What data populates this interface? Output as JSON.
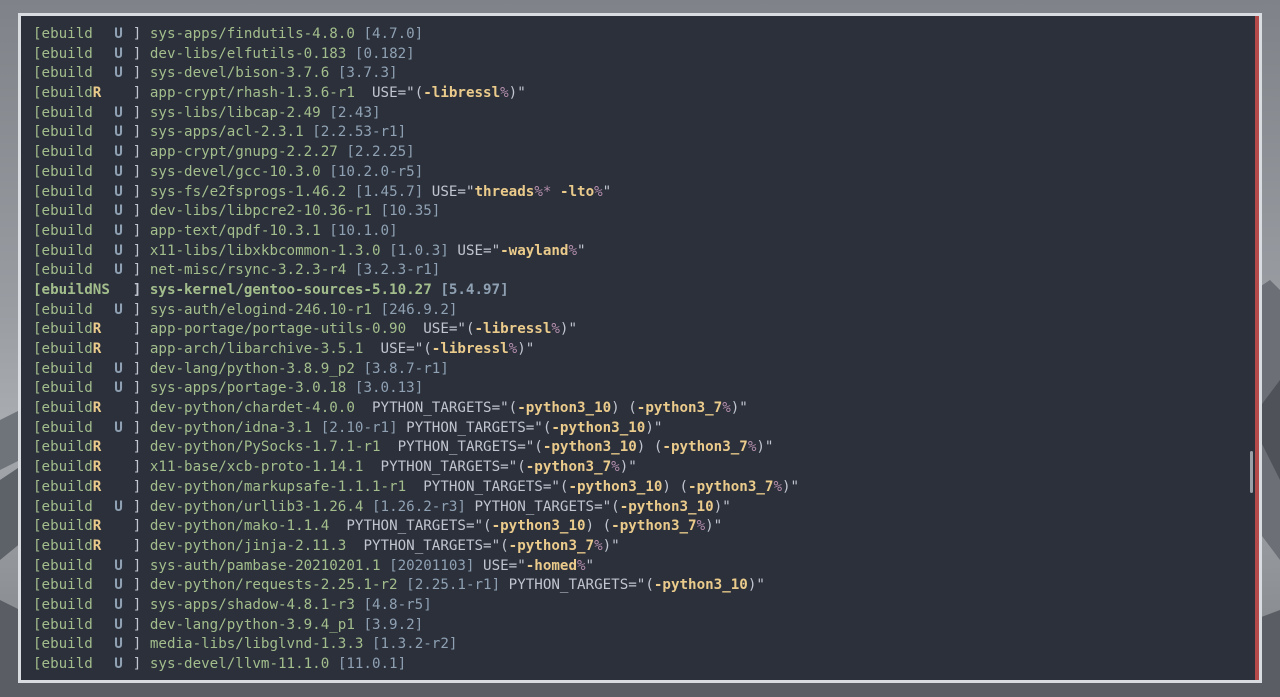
{
  "terminal": {
    "lines": [
      {
        "flag": "U",
        "pkg": "sys-apps/findutils-4.8.0",
        "old": "[4.7.0]",
        "use": []
      },
      {
        "flag": "U",
        "pkg": "dev-libs/elfutils-0.183",
        "old": "[0.182]",
        "use": []
      },
      {
        "flag": "U",
        "pkg": "sys-devel/bison-3.7.6",
        "old": "[3.7.3]",
        "use": []
      },
      {
        "flag": "R",
        "pkg": "app-crypt/rhash-1.3.6-r1",
        "old": "",
        "use": [
          {
            "t": "USE=\"("
          },
          {
            "k": "-libressl"
          },
          {
            "p": "%"
          },
          {
            "t": ")\""
          }
        ]
      },
      {
        "flag": "U",
        "pkg": "sys-libs/libcap-2.49",
        "old": "[2.43]",
        "use": []
      },
      {
        "flag": "U",
        "pkg": "sys-apps/acl-2.3.1",
        "old": "[2.2.53-r1]",
        "use": []
      },
      {
        "flag": "U",
        "pkg": "app-crypt/gnupg-2.2.27",
        "old": "[2.2.25]",
        "use": []
      },
      {
        "flag": "U",
        "pkg": "sys-devel/gcc-10.3.0",
        "old": "[10.2.0-r5]",
        "use": []
      },
      {
        "flag": "U",
        "pkg": "sys-fs/e2fsprogs-1.46.2",
        "old": "[1.45.7]",
        "use": [
          {
            "t": "USE=\""
          },
          {
            "k": "threads"
          },
          {
            "p": "%*"
          },
          {
            "t": " "
          },
          {
            "k": "-lto"
          },
          {
            "p": "%"
          },
          {
            "t": "\""
          }
        ]
      },
      {
        "flag": "U",
        "pkg": "dev-libs/libpcre2-10.36-r1",
        "old": "[10.35]",
        "use": []
      },
      {
        "flag": "U",
        "pkg": "app-text/qpdf-10.3.1",
        "old": "[10.1.0]",
        "use": []
      },
      {
        "flag": "U",
        "pkg": "x11-libs/libxkbcommon-1.3.0",
        "old": "[1.0.3]",
        "use": [
          {
            "t": "USE=\""
          },
          {
            "k": "-wayland"
          },
          {
            "p": "%"
          },
          {
            "t": "\""
          }
        ]
      },
      {
        "flag": "U",
        "pkg": "net-misc/rsync-3.2.3-r4",
        "old": "[3.2.3-r1]",
        "use": []
      },
      {
        "flag": "NS",
        "pkg": "sys-kernel/gentoo-sources-5.10.27",
        "old": "[5.4.97]",
        "use": [],
        "bold": true
      },
      {
        "flag": "U",
        "pkg": "sys-auth/elogind-246.10-r1",
        "old": "[246.9.2]",
        "use": []
      },
      {
        "flag": "R",
        "pkg": "app-portage/portage-utils-0.90",
        "old": "",
        "use": [
          {
            "t": "USE=\"("
          },
          {
            "k": "-libressl"
          },
          {
            "p": "%"
          },
          {
            "t": ")\""
          }
        ]
      },
      {
        "flag": "R",
        "pkg": "app-arch/libarchive-3.5.1",
        "old": "",
        "use": [
          {
            "t": "USE=\"("
          },
          {
            "k": "-libressl"
          },
          {
            "p": "%"
          },
          {
            "t": ")\""
          }
        ]
      },
      {
        "flag": "U",
        "pkg": "dev-lang/python-3.8.9_p2",
        "old": "[3.8.7-r1]",
        "use": []
      },
      {
        "flag": "U",
        "pkg": "sys-apps/portage-3.0.18",
        "old": "[3.0.13]",
        "use": []
      },
      {
        "flag": "R",
        "pkg": "dev-python/chardet-4.0.0",
        "old": "",
        "use": [
          {
            "t": "PYTHON_TARGETS=\"("
          },
          {
            "k": "-python3_10"
          },
          {
            "t": ") ("
          },
          {
            "k": "-python3_7"
          },
          {
            "p": "%"
          },
          {
            "t": ")\""
          }
        ]
      },
      {
        "flag": "U",
        "pkg": "dev-python/idna-3.1",
        "old": "[2.10-r1]",
        "use": [
          {
            "t": "PYTHON_TARGETS=\"("
          },
          {
            "k": "-python3_10"
          },
          {
            "t": ")\""
          }
        ]
      },
      {
        "flag": "R",
        "pkg": "dev-python/PySocks-1.7.1-r1",
        "old": "",
        "use": [
          {
            "t": "PYTHON_TARGETS=\"("
          },
          {
            "k": "-python3_10"
          },
          {
            "t": ") ("
          },
          {
            "k": "-python3_7"
          },
          {
            "p": "%"
          },
          {
            "t": ")\""
          }
        ]
      },
      {
        "flag": "R",
        "pkg": "x11-base/xcb-proto-1.14.1",
        "old": "",
        "use": [
          {
            "t": "PYTHON_TARGETS=\"("
          },
          {
            "k": "-python3_7"
          },
          {
            "p": "%"
          },
          {
            "t": ")\""
          }
        ]
      },
      {
        "flag": "R",
        "pkg": "dev-python/markupsafe-1.1.1-r1",
        "old": "",
        "use": [
          {
            "t": "PYTHON_TARGETS=\"("
          },
          {
            "k": "-python3_10"
          },
          {
            "t": ") ("
          },
          {
            "k": "-python3_7"
          },
          {
            "p": "%"
          },
          {
            "t": ")\""
          }
        ]
      },
      {
        "flag": "U",
        "pkg": "dev-python/urllib3-1.26.4",
        "old": "[1.26.2-r3]",
        "use": [
          {
            "t": "PYTHON_TARGETS=\"("
          },
          {
            "k": "-python3_10"
          },
          {
            "t": ")\""
          }
        ]
      },
      {
        "flag": "R",
        "pkg": "dev-python/mako-1.1.4",
        "old": "",
        "use": [
          {
            "t": "PYTHON_TARGETS=\"("
          },
          {
            "k": "-python3_10"
          },
          {
            "t": ") ("
          },
          {
            "k": "-python3_7"
          },
          {
            "p": "%"
          },
          {
            "t": ")\""
          }
        ]
      },
      {
        "flag": "R",
        "pkg": "dev-python/jinja-2.11.3",
        "old": "",
        "use": [
          {
            "t": "PYTHON_TARGETS=\"("
          },
          {
            "k": "-python3_7"
          },
          {
            "p": "%"
          },
          {
            "t": ")\""
          }
        ]
      },
      {
        "flag": "U",
        "pkg": "sys-auth/pambase-20210201.1",
        "old": "[20201103]",
        "use": [
          {
            "t": "USE=\""
          },
          {
            "k": "-homed"
          },
          {
            "p": "%"
          },
          {
            "t": "\""
          }
        ]
      },
      {
        "flag": "U",
        "pkg": "dev-python/requests-2.25.1-r2",
        "old": "[2.25.1-r1]",
        "use": [
          {
            "t": "PYTHON_TARGETS=\"("
          },
          {
            "k": "-python3_10"
          },
          {
            "t": ")\""
          }
        ]
      },
      {
        "flag": "U",
        "pkg": "sys-apps/shadow-4.8.1-r3",
        "old": "[4.8-r5]",
        "use": []
      },
      {
        "flag": "U",
        "pkg": "dev-lang/python-3.9.4_p1",
        "old": "[3.9.2]",
        "use": []
      },
      {
        "flag": "U",
        "pkg": "media-libs/libglvnd-1.3.3",
        "old": "[1.3.2-r2]",
        "use": []
      },
      {
        "flag": "U",
        "pkg": "sys-devel/llvm-11.1.0",
        "old": "[11.0.1]",
        "use": []
      }
    ],
    "prefix": "[ebuild",
    "close": "]"
  },
  "colors": {
    "background": "#2b303b",
    "text": "#c0c5ce",
    "ebuild": "#a3be8c",
    "update": "#8fa1b3",
    "rebuild": "#ebcb8b",
    "flag_value": "#ebcb8b",
    "percent": "#b48ead",
    "accent": "#b54a4a"
  }
}
